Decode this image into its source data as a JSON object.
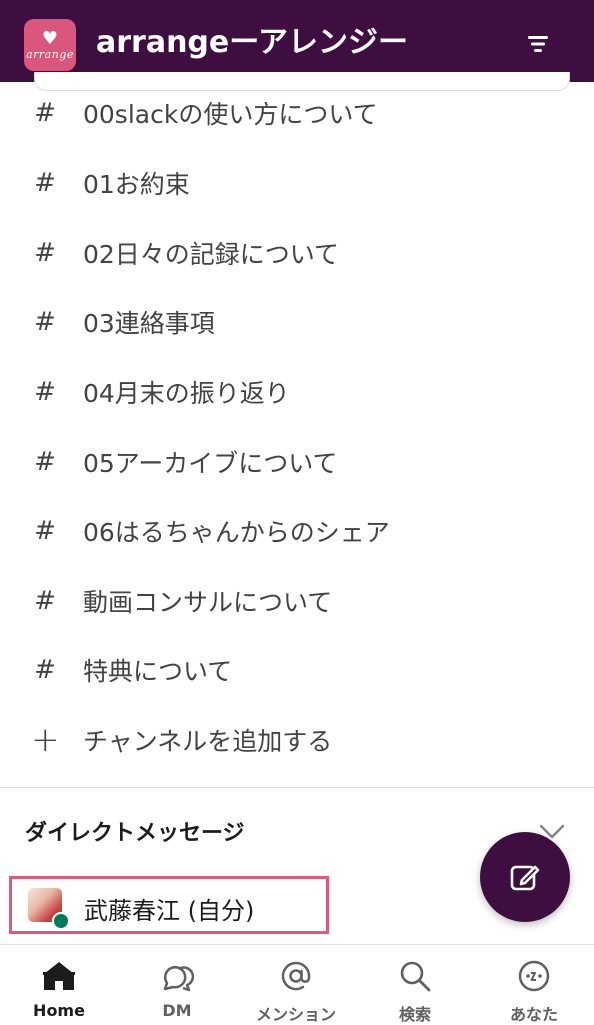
{
  "header": {
    "workspace_title": "arrangeーアレンジー",
    "logo_text": "arrange",
    "filter_icon": "filter-icon"
  },
  "channels": [
    {
      "label": "00slackの使い方について"
    },
    {
      "label": "01お約束"
    },
    {
      "label": "02日々の記録について"
    },
    {
      "label": "03連絡事項"
    },
    {
      "label": "04月末の振り返り"
    },
    {
      "label": "05アーカイブについて"
    },
    {
      "label": "06はるちゃんからのシェア"
    },
    {
      "label": "動画コンサルについて"
    },
    {
      "label": "特典について"
    }
  ],
  "channel_prefix": "#",
  "add_channel": {
    "icon": "+",
    "label": "チャンネルを追加する"
  },
  "dm_section": {
    "title": "ダイレクトメッセージ",
    "items": [
      {
        "name": "武藤春江 (自分)",
        "presence": "active"
      }
    ]
  },
  "colors": {
    "brand": "#3f0e40",
    "highlight": "#e3587a",
    "presence": "#007a5a"
  },
  "bottom_nav": {
    "items": [
      {
        "label": "Home",
        "icon": "home-icon",
        "active": true
      },
      {
        "label": "DM",
        "icon": "dm-icon",
        "active": false
      },
      {
        "label": "メンション",
        "icon": "mention-icon",
        "active": false
      },
      {
        "label": "検索",
        "icon": "search-icon",
        "active": false
      },
      {
        "label": "あなた",
        "icon": "you-icon",
        "active": false
      }
    ]
  }
}
